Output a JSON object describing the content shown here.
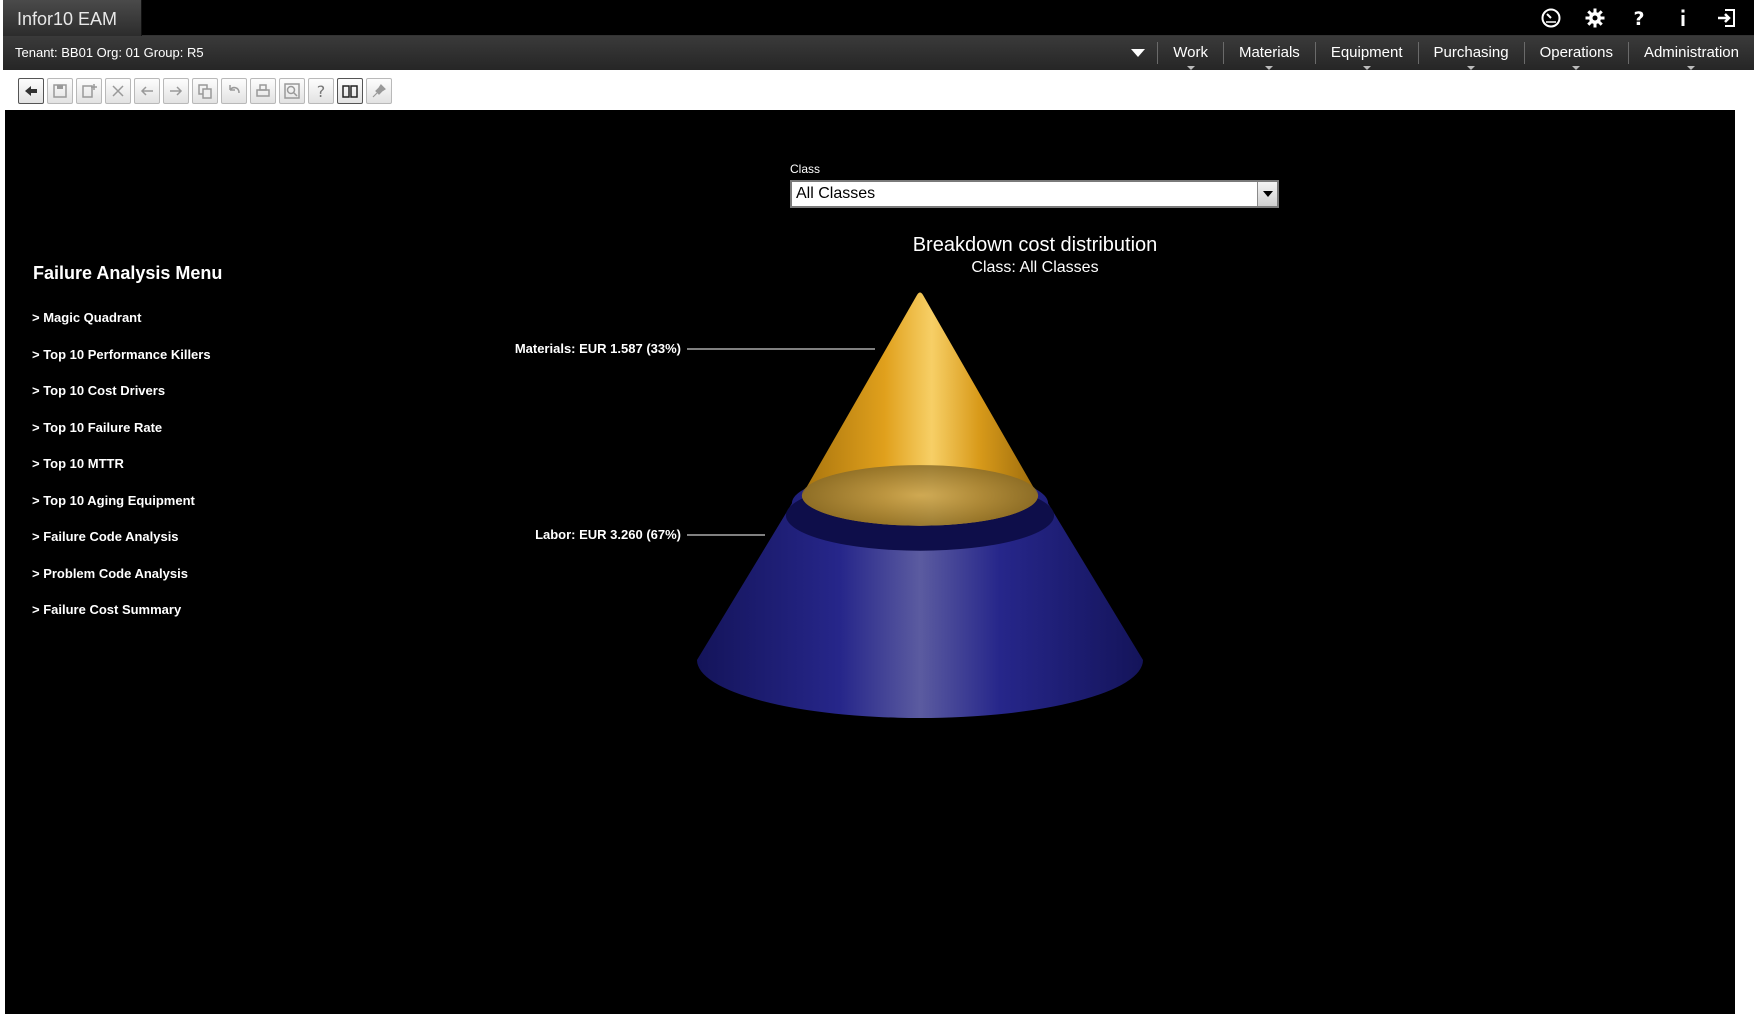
{
  "app": {
    "title": "Infor10  EAM",
    "tenant_info": "Tenant: BB01 Org: 01 Group: R5"
  },
  "top_icons": [
    "clock-icon",
    "gear-icon",
    "help-icon",
    "info-icon",
    "logout-icon"
  ],
  "nav": {
    "items": [
      {
        "label": "Work"
      },
      {
        "label": "Materials"
      },
      {
        "label": "Equipment"
      },
      {
        "label": "Purchasing"
      },
      {
        "label": "Operations"
      },
      {
        "label": "Administration"
      }
    ]
  },
  "toolbar": {
    "buttons": [
      "back-icon",
      "save-icon",
      "new-record-icon",
      "delete-icon",
      "previous-icon",
      "next-icon",
      "copy-icon",
      "undo-icon",
      "print-icon",
      "preview-icon",
      "help-icon",
      "book-icon",
      "pin-icon"
    ]
  },
  "filter": {
    "label": "Class",
    "selected": "All Classes"
  },
  "menu": {
    "title": "Failure Analysis Menu",
    "items": [
      {
        "label": "> Magic Quadrant"
      },
      {
        "label": "> Top 10 Performance Killers"
      },
      {
        "label": "> Top 10 Cost Drivers"
      },
      {
        "label": "> Top 10 Failure Rate"
      },
      {
        "label": "> Top 10 MTTR"
      },
      {
        "label": "> Top 10 Aging Equipment"
      },
      {
        "label": "> Failure Code Analysis"
      },
      {
        "label": "> Problem Code Analysis"
      },
      {
        "label": "> Failure Cost Summary"
      }
    ]
  },
  "chart_data": {
    "type": "cone",
    "title": "Breakdown cost distribution",
    "subtitle": "Class: All Classes",
    "segments": [
      {
        "name": "Materials",
        "value": 1.587,
        "percent": 33,
        "label": "Materials: EUR 1.587  (33%)",
        "color": "#e8a81e"
      },
      {
        "name": "Labor",
        "value": 3.26,
        "percent": 67,
        "label": "Labor: EUR 3.260  (67%)",
        "color": "#22227a"
      }
    ]
  },
  "colors": {
    "background": "#000000",
    "leader_line": "#ffffff"
  }
}
